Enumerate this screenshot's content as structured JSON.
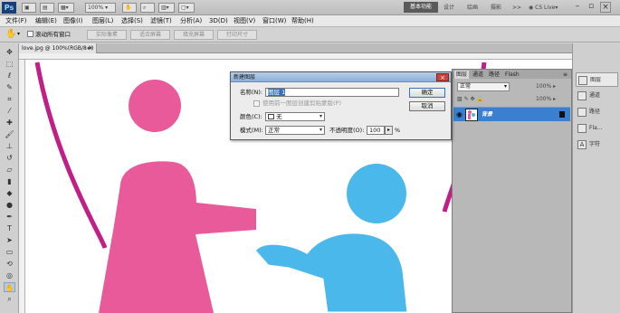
{
  "appbar": {
    "logo": "Ps",
    "zoom_readout": "100%",
    "workspace_active": "基本功能",
    "workspace_tabs": [
      "设计",
      "绘画",
      "摄影"
    ],
    "overflow": ">>",
    "cslive": "CS Live"
  },
  "menu": [
    "文件(F)",
    "编辑(E)",
    "图像(I)",
    "图层(L)",
    "选择(S)",
    "滤镜(T)",
    "分析(A)",
    "3D(D)",
    "视图(V)",
    "窗口(W)",
    "帮助(H)"
  ],
  "options": {
    "scroll_all_label": "滚动所有窗口",
    "buttons": [
      "实际像素",
      "适合屏幕",
      "填充屏幕",
      "打印尺寸"
    ]
  },
  "document": {
    "tab_label": "love.jpg @ 100%(RGB/8#)",
    "close": "×"
  },
  "dialog": {
    "title": "新建图层",
    "name_label": "名称(N):",
    "name_value": "图层 1",
    "checkbox_label": "使用前一图层创建剪贴蒙版(P)",
    "color_label": "颜色(C):",
    "color_value": "无",
    "mode_label": "模式(M):",
    "mode_value": "正常",
    "opacity_label": "不透明度(O):",
    "opacity_value": "100",
    "opacity_unit": "%",
    "ok_label": "确定",
    "cancel_label": "取消"
  },
  "layers_panel": {
    "tabs": [
      "图层",
      "通道",
      "路径",
      "Flash"
    ],
    "blend_mode": "正常",
    "opacity_value": "100%",
    "fill_value": "100%",
    "layer_name": "背景"
  },
  "right_panels": [
    "图层",
    "通道",
    "路径",
    "Fla...",
    "字符"
  ],
  "colors": {
    "pink": "#e95a9a",
    "blue": "#4ab8ea",
    "arc": "#c01f87",
    "layer_selected": "#3a7fd0"
  }
}
